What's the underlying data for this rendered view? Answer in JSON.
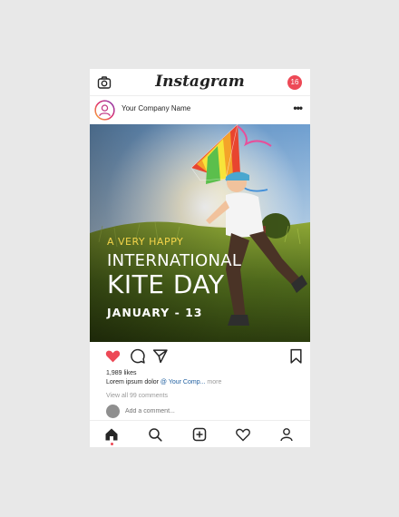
{
  "header": {
    "title": "Instagram",
    "notification_count": "16",
    "icons": [
      "camera-icon"
    ]
  },
  "post": {
    "company_name": "Your Company Name",
    "more_icon": "more-dots-icon",
    "image_text": {
      "line1": "A VERY HAPPY",
      "line2": "INTERNATIONAL",
      "line3": "KITE DAY",
      "line4": "JANUARY - 13"
    },
    "actions": [
      "heart-filled-icon",
      "comment-icon",
      "share-icon",
      "bookmark-icon"
    ],
    "likes": "1,989 likes",
    "caption_text": "Lorem ipsum dolor ",
    "caption_tag": "@ Your Comp...",
    "caption_more": "more",
    "view_comments": "View all 99 comments",
    "add_comment_placeholder": "Add a comment..."
  },
  "bottom_nav": [
    "home-icon",
    "search-icon",
    "add-post-icon",
    "heart-icon",
    "profile-icon"
  ],
  "colors": {
    "accent_red": "#ed4956",
    "tag_blue": "#1f5fa0",
    "kite_text_yellow": "#f3d44a"
  }
}
